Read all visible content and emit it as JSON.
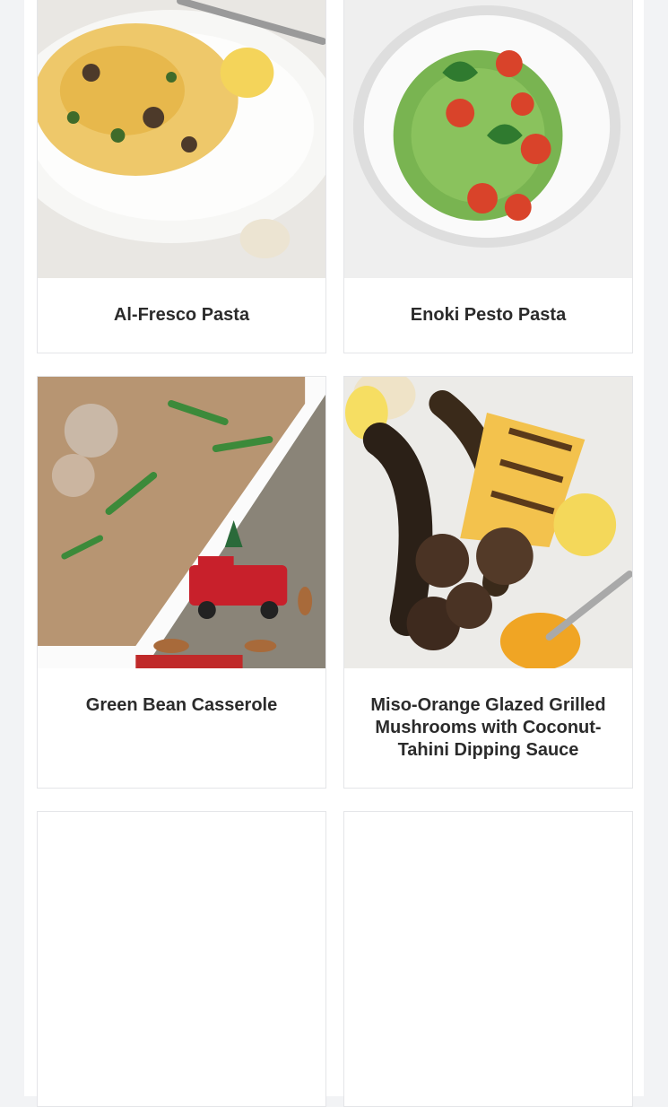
{
  "recipes": [
    {
      "title": "Al-Fresco Pasta",
      "image": "al-fresco-pasta-photo"
    },
    {
      "title": "Enoki Pesto Pasta",
      "image": "enoki-pesto-pasta-photo"
    },
    {
      "title": "Green Bean Casserole",
      "image": "green-bean-casserole-photo"
    },
    {
      "title": "Miso-Orange Glazed Grilled Mushrooms with Coconut-Tahini Dipping Sauce",
      "image": "grilled-mushrooms-photo"
    },
    {
      "title": "",
      "image": ""
    },
    {
      "title": "",
      "image": ""
    }
  ],
  "colors": {
    "page_background": "#f2f3f5",
    "card_border": "#e4e5e8",
    "title_text": "#2b2b2b"
  }
}
